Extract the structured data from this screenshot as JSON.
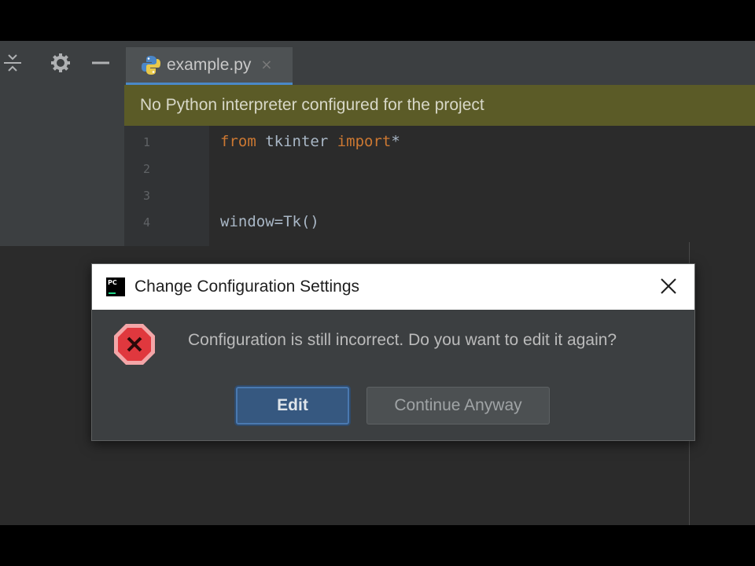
{
  "tab": {
    "label": "example.py",
    "close": "×"
  },
  "toolbar": {
    "icons": [
      "collapse-icon",
      "gear-icon",
      "minimize-icon"
    ]
  },
  "banner": {
    "text": "No Python interpreter configured for the project"
  },
  "editor": {
    "line_numbers": [
      "1",
      "2",
      "3",
      "4"
    ],
    "lines": [
      {
        "keyword1": "from",
        "plain": " tkinter ",
        "keyword2": "import",
        "tail": "*"
      },
      {
        "text": ""
      },
      {
        "text": ""
      },
      {
        "text": "window=Tk()"
      }
    ]
  },
  "dialog": {
    "title": "Change Configuration Settings",
    "app_icon_text": "PC",
    "message": "Configuration is still incorrect. Do you want to edit it again?",
    "buttons": {
      "edit": "Edit",
      "continue": "Continue Anyway"
    }
  },
  "colors": {
    "accent": "#365880",
    "banner": "#5b5b27",
    "error": "#e0383e"
  }
}
